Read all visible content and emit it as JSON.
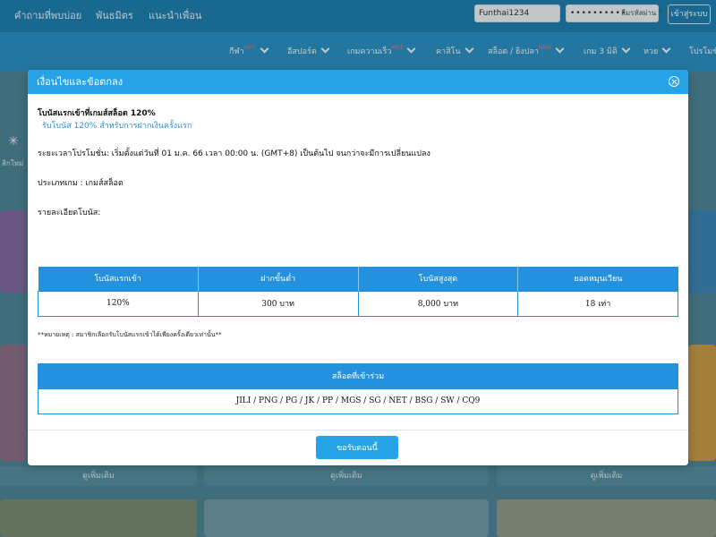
{
  "topbar": {
    "links": [
      "คำถามที่พบบ่อย",
      "พันธมิตร",
      "แนะนำเพื่อน"
    ],
    "username_value": "Funthai1234",
    "password_value": "••••••••••",
    "forgot_label": "ลืมรหัสผ่าน ?",
    "login_label": "เข้าสู่ระบบ"
  },
  "nav": {
    "items": [
      {
        "label": "กีฬา",
        "tag": "HOT"
      },
      {
        "label": "อีสปอร์ต",
        "tag": ""
      },
      {
        "label": "เกมความเร็ว",
        "tag": "HOT"
      },
      {
        "label": "คาสิโน",
        "tag": ""
      },
      {
        "label": "สล็อต / ยิงปลา",
        "tag": "NEW"
      },
      {
        "label": "เกม 3 มิติ",
        "tag": ""
      },
      {
        "label": "หวย",
        "tag": ""
      },
      {
        "label": "โปรโมชั่น",
        "tag": ""
      }
    ]
  },
  "background": {
    "side_label": "สิกใหม่",
    "more_label": "ดูเพิ่มเติม"
  },
  "modal": {
    "title": "เงื่อนไขและข้อตกลง",
    "bonus_title": "โบนัสแรกเข้าที่เกมส์สล็อต 120%",
    "bonus_subtitle": "รับโบนัส 120% สำหรับการฝากเงินครั้งแรก",
    "period": "ระยะเวลาโปรโมชั่น: เริ่มตั้งแต่วันที่ 01 ม.ค. 66 เวลา 00:00 น. (GMT+8) เป็นต้นไป จนกว่าจะมีการเปลี่ยนแปลง",
    "game_type": "ประเภทเกม : เกมส์สล็อต",
    "details_label": "รายละเอียดโบนัส:",
    "table": {
      "headers": [
        "โบนัสแรกเข้า",
        "ฝากขั้นต่ำ",
        "โบนัสสูงสุด",
        "ยอดหมุนเวียน"
      ],
      "row": [
        "120%",
        "300 บาท",
        "8,000 บาท",
        "18 เท่า"
      ]
    },
    "note": "**หมายเหตุ : สมาชิกเลือกรับโบนัสแรกเข้าได้เพียงครั้งเดียวเท่านั้น**",
    "slots_header": "สล็อตที่เข้าร่วม",
    "slots_list": "JILI / PNG / PG / JK / PP / MGS / SG / NET / BSG / SW / CQ9",
    "accept_label": "ขอรับตอนนี้"
  }
}
